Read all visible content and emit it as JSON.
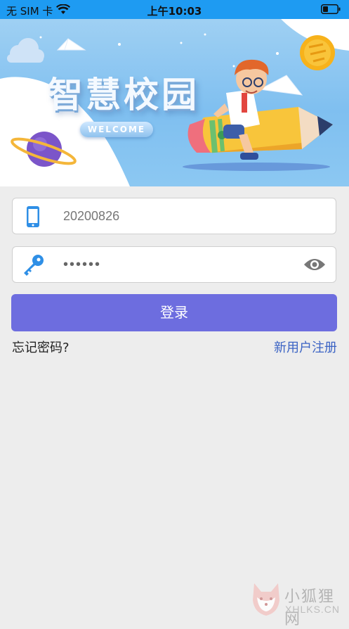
{
  "status_bar": {
    "carrier": "无 SIM 卡",
    "time": "上午10:03"
  },
  "banner": {
    "title": "智慧校园",
    "welcome": "WELCOME"
  },
  "form": {
    "phone_value": "20200826",
    "password_mask": "••••••",
    "login_label": "登录",
    "forgot_label": "忘记密码?",
    "register_label": "新用户注册"
  },
  "watermark": {
    "name": "小狐狸网",
    "domain": "XHLKS.CN"
  },
  "colors": {
    "status_bar": "#1e9bf2",
    "primary_button": "#6d6ddf",
    "link": "#3b63c4",
    "background": "#ededed"
  }
}
